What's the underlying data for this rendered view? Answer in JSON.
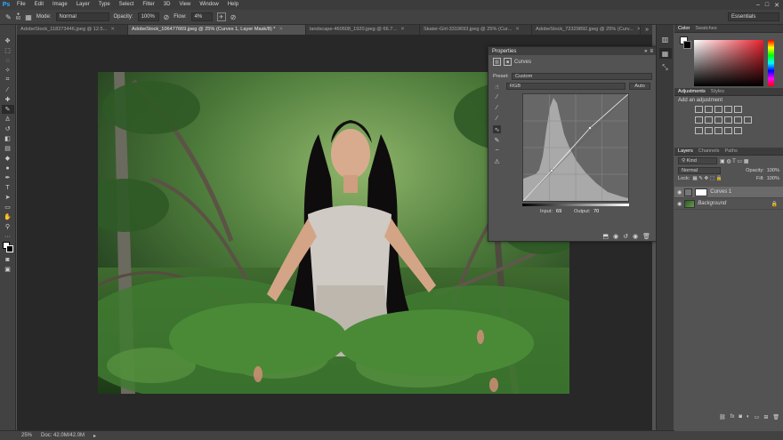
{
  "app": {
    "logo": "Ps",
    "win_min": "–",
    "win_max": "□",
    "win_close": "✕"
  },
  "menu": [
    "File",
    "Edit",
    "Image",
    "Layer",
    "Type",
    "Select",
    "Filter",
    "3D",
    "View",
    "Window",
    "Help"
  ],
  "options": {
    "brush_size": "60",
    "mode_label": "Mode:",
    "mode_value": "Normal",
    "opacity_label": "Opacity:",
    "opacity_value": "100%",
    "flow_label": "Flow:",
    "flow_value": "4%",
    "workspace": "Essentials"
  },
  "tabs": [
    {
      "label": "AdobeStock_118273446.jpeg @ 12.5...",
      "active": false
    },
    {
      "label": "AdobeStock_106477669.jpeg @ 25% (Curves 1, Layer Mask/8) *",
      "active": true
    },
    {
      "label": "landscape-460608_1920.jpeg @ 66.7...",
      "active": false
    },
    {
      "label": "Skater-Girl-3319693.jpeg @ 25% (Cur...",
      "active": false
    },
    {
      "label": "AdobeStock_72329892.jpeg @ 25% (Curv...",
      "active": false
    }
  ],
  "tab_more": "»",
  "status": {
    "zoom": "25%",
    "doc": "Doc: 42.0M/42.0M",
    "arrow": "▸"
  },
  "properties": {
    "title": "Properties",
    "subtitle": "Curves",
    "preset_label": "Preset:",
    "preset_value": "Custom",
    "channel_value": "RGB",
    "auto_label": "Auto",
    "input_label": "Input:",
    "input_value": "69",
    "output_label": "Output:",
    "output_value": "70"
  },
  "color_panel": {
    "tab1": "Color",
    "tab2": "Swatches"
  },
  "adjustments": {
    "tab1": "Adjustments",
    "tab2": "Styles",
    "hint": "Add an adjustment"
  },
  "layers_panel": {
    "tab1": "Layers",
    "tab2": "Channels",
    "tab3": "Paths",
    "filter": "Kind",
    "blend": "Normal",
    "opacity_label": "Opacity:",
    "opacity_value": "100%",
    "lock_label": "Lock:",
    "fill_label": "Fill:",
    "fill_value": "100%",
    "layers": [
      {
        "name": "Curves 1",
        "selected": true
      },
      {
        "name": "Background",
        "selected": false
      }
    ],
    "footer_fx": "fx"
  },
  "colors": {
    "accent": "#31a8ff",
    "panel": "#535353",
    "dark": "#282828"
  }
}
